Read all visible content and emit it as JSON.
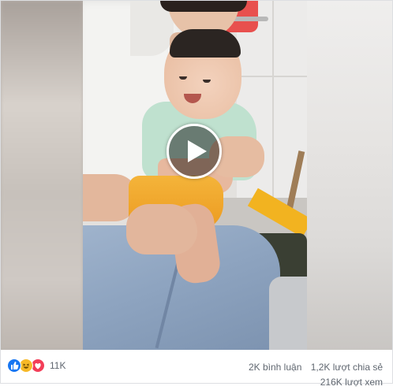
{
  "video": {
    "play_icon": "play-icon"
  },
  "reactions": {
    "icons": [
      "like-icon",
      "haha-icon",
      "love-icon"
    ],
    "count": "11K",
    "colors": {
      "like": "#1877f2",
      "haha": "#f7b928",
      "love": "#f33e58"
    }
  },
  "stats": {
    "comments": "2K bình luận",
    "shares": "1,2K lượt chia sẻ",
    "views": "216K lượt xem"
  }
}
